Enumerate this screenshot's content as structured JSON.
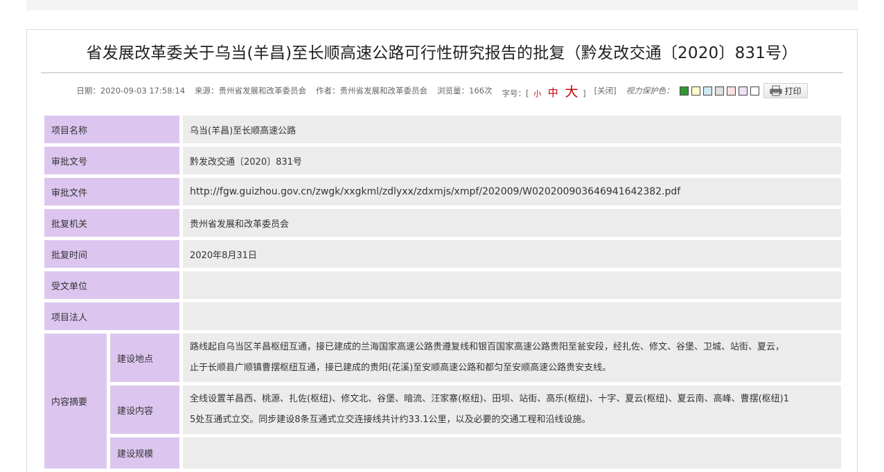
{
  "article": {
    "title": "省发展改革委关于乌当(羊昌)至长顺高速公路可行性研究报告的批复（黔发改交通〔2020〕831号）"
  },
  "meta": {
    "date_label": "日期：",
    "date": "2020-09-03 17:58:14",
    "source_label": "来源：",
    "source": "贵州省发展和改革委员会",
    "author_label": "作者：",
    "author": "贵州省发展和改革委员会",
    "views_label": "浏览量：",
    "views": "166次",
    "fontsize_label": "字号：[",
    "size_small": "小",
    "size_medium": "中",
    "size_large": "大",
    "fontsize_close": "]",
    "close_link": "[关闭]",
    "eye_protect_label": "视力保护色：",
    "print_label": "打印",
    "swatch_colors": [
      "#339933",
      "#ffffcc",
      "#cce8f4",
      "#e0e0e0",
      "#fde0e0",
      "#f0e0f8",
      "#ffffff"
    ]
  },
  "details": {
    "project_name_label": "项目名称",
    "project_name": "乌当(羊昌)至长顺高速公路",
    "approval_no_label": "审批文号",
    "approval_no": "黔发改交通〔2020〕831号",
    "approval_file_label": "审批文件",
    "approval_file": "http://fgw.guizhou.gov.cn/zwgk/xxgkml/zdlyxx/zdxmjs/xmpf/202009/W020200903646941642382.pdf",
    "approval_org_label": "批复机关",
    "approval_org": "贵州省发展和改革委员会",
    "approval_time_label": "批复时间",
    "approval_time": "2020年8月31日",
    "recipient_label": "受文单位",
    "recipient": "",
    "legal_person_label": "项目法人",
    "legal_person": "",
    "summary_label": "内容摘要",
    "location_label": "建设地点",
    "location_line1": "路线起自乌当区羊昌枢纽互通，接已建成的兰海国家高速公路贵遵复线和银百国家高速公路贵阳至瓮安段，经扎佐、修文、谷堡、卫城、站街、夏云，",
    "location_line2": "止于长顺县广顺镇曹摆枢纽互通，接已建成的贵阳(花溪)至安顺高速公路和都匀至安顺高速公路贵安支线。",
    "content_label": "建设内容",
    "content_line1": "全线设置羊昌西、桃源、扎佐(枢纽)、修文北、谷堡、暗流、汪家寨(枢纽)、田坝、站街、高乐(枢纽)、十字、夏云(枢纽)、夏云南、高峰、曹摆(枢纽)1",
    "content_line2": "5处互通式立交。同步建设8条互通式立交连接线共计约33.1公里，以及必要的交通工程和沿线设施。",
    "scale_label": "建设规模",
    "scale": ""
  }
}
